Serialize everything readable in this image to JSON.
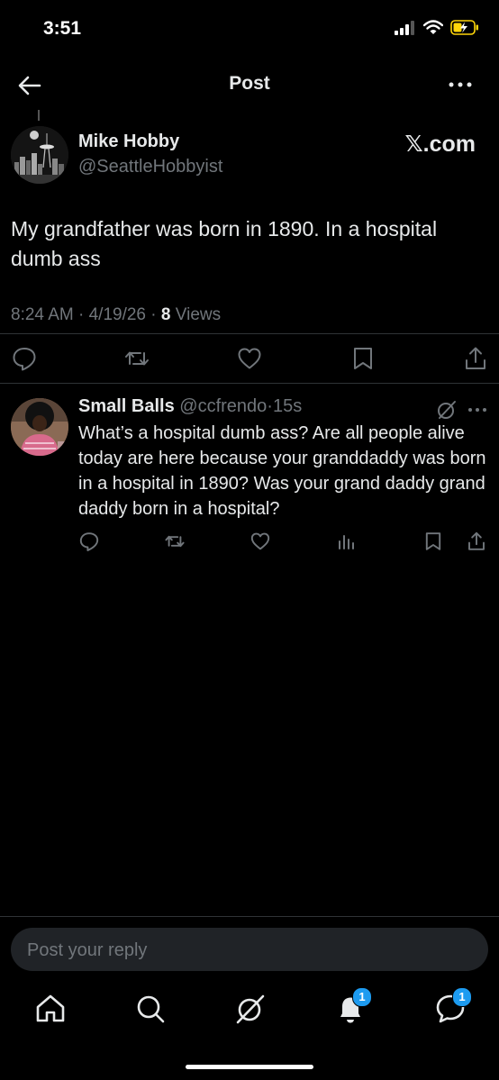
{
  "status_bar": {
    "time": "3:51",
    "icons": [
      "signal-icon",
      "wifi-icon",
      "battery-charging-icon"
    ]
  },
  "header": {
    "title": "Post",
    "back_icon": "arrow-left-icon",
    "more_icon": "more-horizontal-icon"
  },
  "post": {
    "author_name": "Mike Hobby",
    "author_handle": "@SeattleHobbyist",
    "source": "𝕏.com",
    "text": "My grandfather was born in 1890. In a hospital dumb ass",
    "time": "8:24 AM",
    "date": "4/19/26",
    "views_count": "8",
    "views_label": "Views",
    "actions": [
      "reply-icon",
      "repost-icon",
      "like-icon",
      "bookmark-icon",
      "share-icon"
    ]
  },
  "reply": {
    "author_name": "Small Balls",
    "author_handle": "@ccfrendo",
    "time": "15s",
    "text": "What’s a hospital dumb ass? Are all people alive today are here because your granddaddy was born in a hospital in 1890? Was your grand daddy grand daddy born in a hospital?",
    "actions": [
      "reply-icon",
      "repost-icon",
      "like-icon",
      "views-icon",
      "bookmark-icon",
      "share-icon"
    ]
  },
  "composer": {
    "placeholder": "Post your reply"
  },
  "bottom_nav": {
    "items": [
      {
        "icon": "home-icon"
      },
      {
        "icon": "search-icon"
      },
      {
        "icon": "grok-icon"
      },
      {
        "icon": "notifications-icon",
        "badge": "1"
      },
      {
        "icon": "messages-icon",
        "badge": "1"
      }
    ]
  },
  "colors": {
    "background": "#000000",
    "text": "#e7e9ea",
    "muted": "#71767b",
    "divider": "#2f3336",
    "accent": "#1d9bf0"
  }
}
